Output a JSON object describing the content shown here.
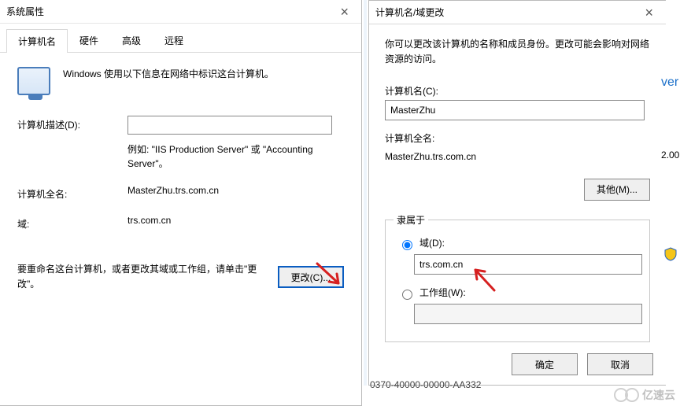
{
  "left_dialog": {
    "title": "系统属性",
    "close_label": "×",
    "tabs": {
      "computer_name": "计算机名",
      "hardware": "硬件",
      "advanced": "高级",
      "remote": "远程"
    },
    "intro": "Windows 使用以下信息在网络中标识这台计算机。",
    "desc_label": "计算机描述(D):",
    "desc_value": "",
    "desc_hint": "例如: \"IIS Production Server\" 或 \"Accounting Server\"。",
    "fullname_label": "计算机全名:",
    "fullname_value": "MasterZhu.trs.com.cn",
    "domain_label": "域:",
    "domain_value": "trs.com.cn",
    "rename_text": "要重命名这台计算机，或者更改其域或工作组，请单击\"更改\"。",
    "change_btn": "更改(C)..."
  },
  "right_dialog": {
    "title": "计算机名/域更改",
    "close_label": "×",
    "info": "你可以更改该计算机的名称和成员身份。更改可能会影响对网络资源的访问。",
    "cname_label": "计算机名(C):",
    "cname_value": "MasterZhu",
    "fullname_label": "计算机全名:",
    "fullname_value": "MasterZhu.trs.com.cn",
    "other_btn": "其他(M)...",
    "fieldset_legend": "隶属于",
    "radio_domain_label": "域(D):",
    "domain_input_value": "trs.com.cn",
    "radio_workgroup_label": "工作组(W):",
    "workgroup_input_value": "",
    "ok_btn": "确定",
    "cancel_btn": "取消"
  },
  "background": {
    "partial_text1": "ver",
    "partial_text2": "2.00",
    "serial_fragment": "0370-40000-00000-AA332"
  },
  "watermark": {
    "text": "亿速云"
  }
}
